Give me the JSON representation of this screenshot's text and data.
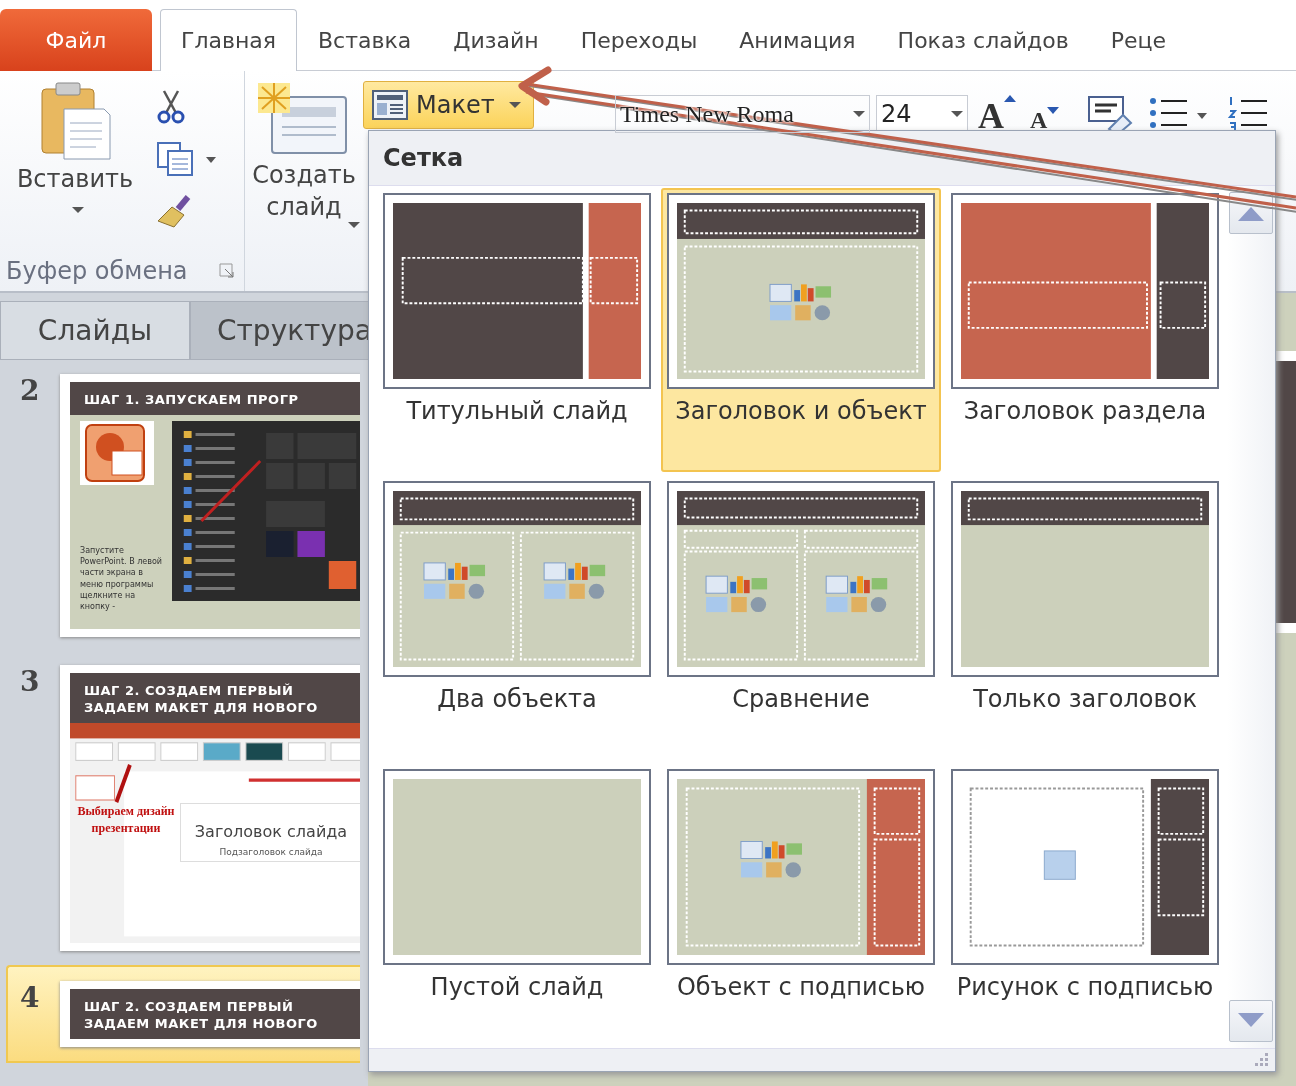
{
  "tabs": [
    {
      "label": "Файл",
      "kind": "file",
      "selected": false
    },
    {
      "label": "Главная",
      "kind": "tab",
      "selected": true
    },
    {
      "label": "Вставка",
      "kind": "tab",
      "selected": false
    },
    {
      "label": "Дизайн",
      "kind": "tab",
      "selected": false
    },
    {
      "label": "Переходы",
      "kind": "tab",
      "selected": false
    },
    {
      "label": "Анимация",
      "kind": "tab",
      "selected": false
    },
    {
      "label": "Показ слайдов",
      "kind": "tab",
      "selected": false
    },
    {
      "label": "Реце",
      "kind": "tab",
      "selected": false
    }
  ],
  "ribbon": {
    "paste_label": "Вставить",
    "clipboard_group": "Буфер обмена",
    "new_slide_label": [
      "Создать",
      "слайд"
    ],
    "layout_button": {
      "label": "Макет",
      "expanded": true
    },
    "font_name": "Times New Roma",
    "font_size": "24",
    "grow_font": "A",
    "shrink_font": "A"
  },
  "slides_pane": {
    "tabs": [
      {
        "label": "Слайды",
        "selected": true
      },
      {
        "label": "Структура",
        "selected": false
      }
    ],
    "slides": [
      {
        "number": "2",
        "selected": false,
        "kind": "start",
        "title": [
          "ШАГ 1. ЗАПУСКАЕМ ПРОГР"
        ],
        "caption": "Запустите PowerPoint. В левой части экрана в меню программы щелкните на кнопку -"
      },
      {
        "number": "3",
        "selected": false,
        "kind": "design",
        "title": [
          "ШАГ 2. СОЗДАЕМ ПЕРВЫЙ",
          "ЗАДАЕМ МАКЕТ ДЛЯ НОВОГО"
        ],
        "caption": "Выбираем дизайн презентации",
        "slide_title": "Заголовок слайда",
        "slide_subtitle": "Подзаголовок слайда"
      },
      {
        "number": "4",
        "selected": true,
        "kind": "layout",
        "title": [
          "ШАГ 2. СОЗДАЕМ ПЕРВЫЙ",
          "ЗАДАЕМ МАКЕТ ДЛЯ НОВОГО"
        ]
      }
    ]
  },
  "layout_gallery": {
    "heading": "Сетка",
    "layouts": [
      {
        "label": "Титульный слайд",
        "kind": "title",
        "selected": false
      },
      {
        "label": "Заголовок и объект",
        "kind": "title-content",
        "selected": true
      },
      {
        "label": "Заголовок раздела",
        "kind": "section",
        "selected": false
      },
      {
        "label": "Два объекта",
        "kind": "two-content",
        "selected": false
      },
      {
        "label": "Сравнение",
        "kind": "comparison",
        "selected": false
      },
      {
        "label": "Только заголовок",
        "kind": "title-only",
        "selected": false
      },
      {
        "label": "Пустой слайд",
        "kind": "blank",
        "selected": false
      },
      {
        "label": "Объект с подписью",
        "kind": "content-caption",
        "selected": false
      },
      {
        "label": "Рисунок с подписью",
        "kind": "picture-caption",
        "selected": false
      }
    ]
  }
}
